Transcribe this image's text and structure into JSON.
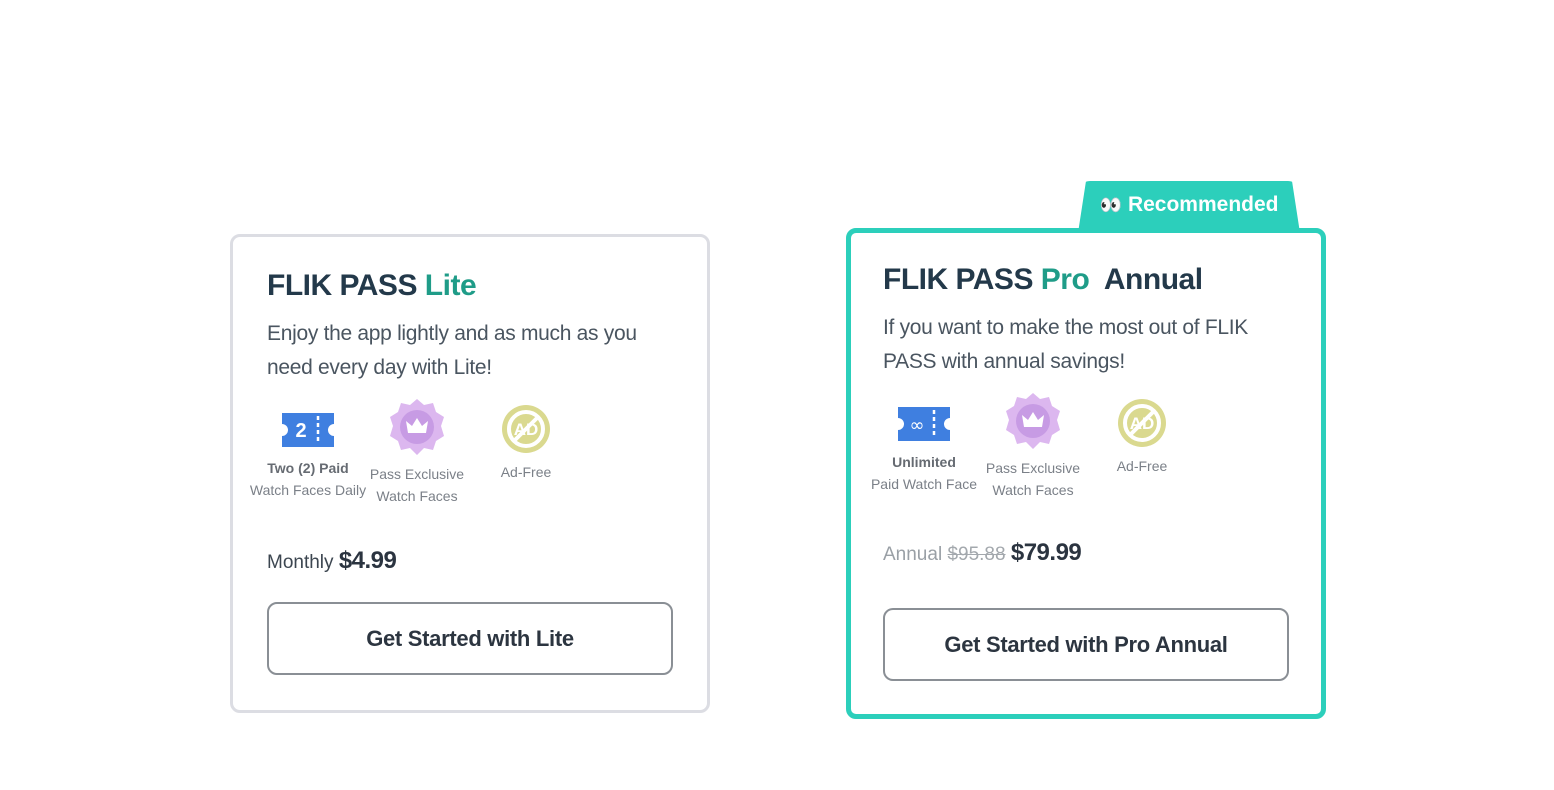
{
  "lite": {
    "title_main": "FLIK PASS",
    "title_accent": "Lite",
    "description": "Enjoy the app lightly and as much as you need every day with Lite!",
    "features": [
      {
        "icon": "ticket-2-icon",
        "ticket_text": "2",
        "line1": "Two (2) Paid",
        "line2": "Watch Faces Daily"
      },
      {
        "icon": "crown-badge-icon",
        "line1": "Pass Exclusive",
        "line2": "Watch Faces"
      },
      {
        "icon": "no-ads-icon",
        "line1": "Ad-Free"
      }
    ],
    "price_label": "Monthly",
    "price": "$4.99",
    "cta_label": "Get Started with Lite"
  },
  "pro": {
    "badge_emoji": "👀",
    "badge_label": "Recommended",
    "title_main": "FLIK PASS",
    "title_accent": "Pro",
    "title_suffix": "Annual",
    "description": "If you want to make the most out of FLIK PASS with annual savings!",
    "features": [
      {
        "icon": "ticket-infinity-icon",
        "ticket_text": "∞",
        "line1": "Unlimited",
        "line2": "Paid Watch Face"
      },
      {
        "icon": "crown-badge-icon",
        "line1": "Pass Exclusive",
        "line2": "Watch Faces"
      },
      {
        "icon": "no-ads-icon",
        "line1": "Ad-Free"
      }
    ],
    "price_label": "Annual",
    "price_original": "$95.88",
    "price": "$79.99",
    "cta_label": "Get Started with Pro Annual"
  },
  "colors": {
    "accent": "#2ccfbb",
    "title_accent": "#1f9c88",
    "title": "#23394a",
    "ticket_blue": "#3f7fe0",
    "badge_purple": "#dcb7ef",
    "noad_olive": "#dad98f"
  }
}
